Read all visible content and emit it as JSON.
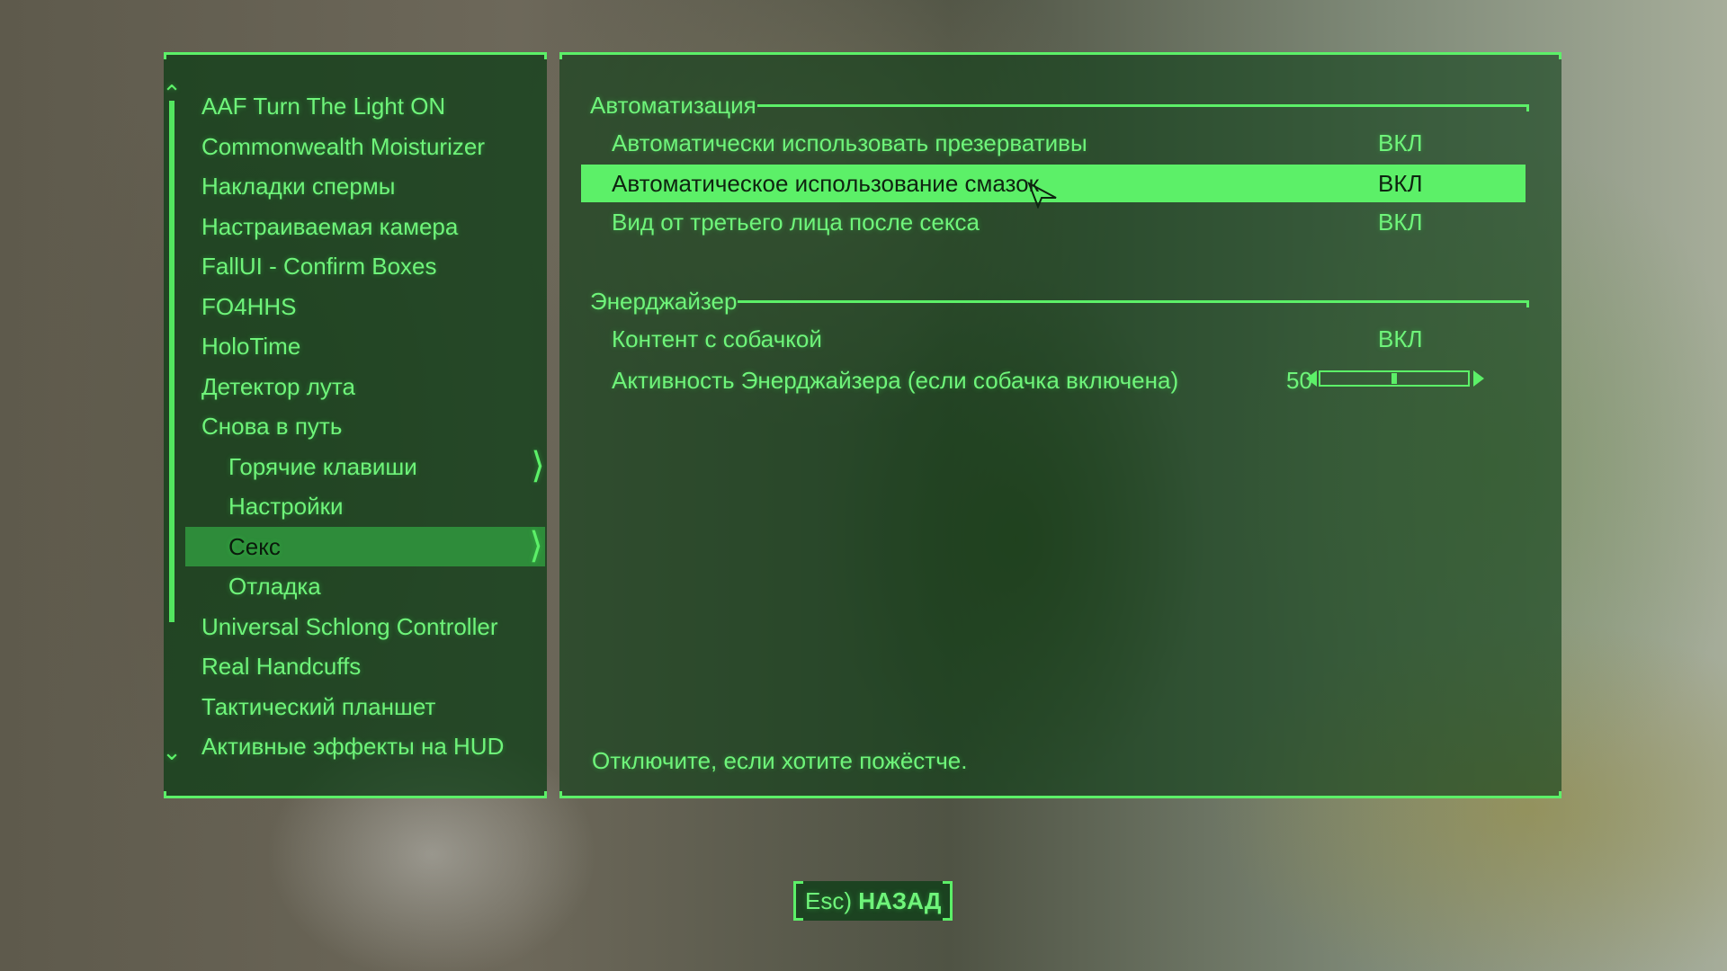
{
  "mod_list": {
    "items": [
      {
        "label": "AAF Turn The Light ON",
        "sub": false,
        "selected": false,
        "expandable": false
      },
      {
        "label": "Commonwealth Moisturizer",
        "sub": false,
        "selected": false,
        "expandable": false
      },
      {
        "label": "Накладки спермы",
        "sub": false,
        "selected": false,
        "expandable": false
      },
      {
        "label": "Настраиваемая камера",
        "sub": false,
        "selected": false,
        "expandable": false
      },
      {
        "label": "FallUI - Confirm Boxes",
        "sub": false,
        "selected": false,
        "expandable": false
      },
      {
        "label": "FO4HHS",
        "sub": false,
        "selected": false,
        "expandable": false
      },
      {
        "label": "HoloTime",
        "sub": false,
        "selected": false,
        "expandable": false
      },
      {
        "label": "Детектор лута",
        "sub": false,
        "selected": false,
        "expandable": false
      },
      {
        "label": "Снова в путь",
        "sub": false,
        "selected": false,
        "expandable": false
      },
      {
        "label": "Горячие клавиши",
        "sub": true,
        "selected": false,
        "expandable": true
      },
      {
        "label": "Настройки",
        "sub": true,
        "selected": false,
        "expandable": false
      },
      {
        "label": "Секс",
        "sub": true,
        "selected": true,
        "expandable": true
      },
      {
        "label": "Отладка",
        "sub": true,
        "selected": false,
        "expandable": false
      },
      {
        "label": "Universal Schlong Controller",
        "sub": false,
        "selected": false,
        "expandable": false
      },
      {
        "label": "Real Handcuffs",
        "sub": false,
        "selected": false,
        "expandable": false
      },
      {
        "label": "Тактический планшет",
        "sub": false,
        "selected": false,
        "expandable": false
      },
      {
        "label": "Активные эффекты на HUD",
        "sub": false,
        "selected": false,
        "expandable": false
      }
    ]
  },
  "settings": {
    "sections": [
      {
        "title": "Автоматизация",
        "rows": [
          {
            "label": "Автоматически использовать презервативы",
            "value": "ВКЛ"
          },
          {
            "label": "Автоматическое использование смазок",
            "value": "ВКЛ"
          },
          {
            "label": "Вид от третьего лица после секса",
            "value": "ВКЛ"
          }
        ]
      },
      {
        "title": "Энерджайзер",
        "rows": [
          {
            "label": "Контент с собачкой",
            "value": "ВКЛ"
          },
          {
            "label": "Активность Энерджайзера (если собачка включена)",
            "value": "50"
          }
        ]
      }
    ],
    "highlighted_row": "Автоматическое использование смазок",
    "slider": {
      "value": 50,
      "fraction": 0.5
    },
    "description": "Отключите, если хотите пожёстче."
  },
  "footer": {
    "back_key": "Esc)",
    "back_label": "НАЗАД",
    "bracket_left": "[",
    "bracket_right": "]"
  },
  "colors": {
    "accent": "#5cf068",
    "selected_bg": "#2e8c3a",
    "highlight_bg": "#5cf068"
  }
}
